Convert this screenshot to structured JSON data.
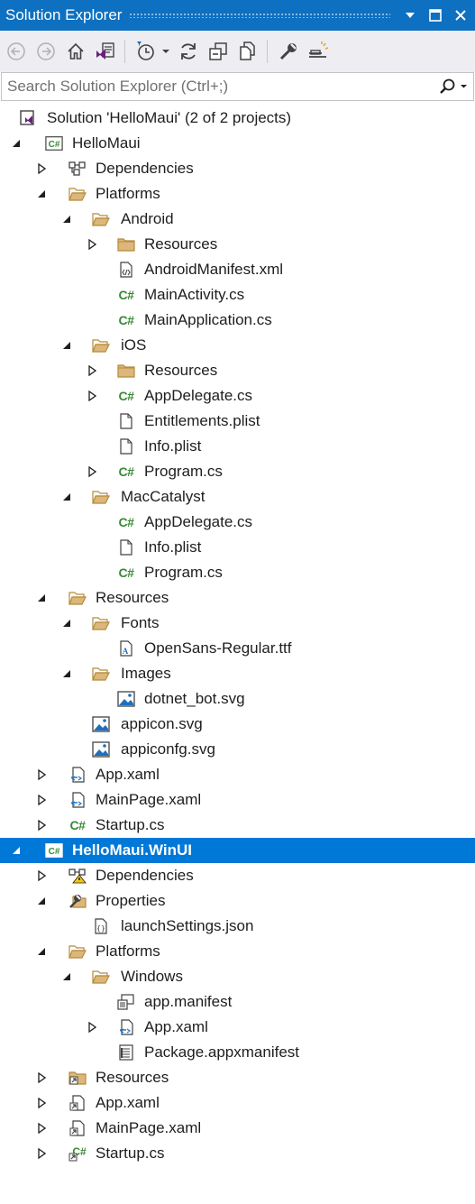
{
  "window": {
    "title": "Solution Explorer"
  },
  "search": {
    "placeholder": "Search Solution Explorer (Ctrl+;)"
  },
  "toolbar": {
    "buttons": [
      "back-icon",
      "forward-icon",
      "home-icon",
      "switch-views-icon",
      "pending-changes-filter-icon",
      "sync-icon",
      "collapse-all-icon",
      "show-all-files-icon",
      "properties-icon",
      "preview-icon"
    ]
  },
  "colors": {
    "accent": "#0e70c0",
    "selection": "#0078d7",
    "csharp": "#388a34",
    "folder": "#dcb67a",
    "toolbar_bg": "#eeeef2"
  },
  "tree": [
    {
      "label": "Solution 'HelloMaui' (2 of 2 projects)",
      "depth": 0,
      "expander": "none",
      "icon": "solution-icon"
    },
    {
      "label": "HelloMaui",
      "depth": 1,
      "expander": "expanded",
      "icon": "csharp-project-icon"
    },
    {
      "label": "Dependencies",
      "depth": 2,
      "expander": "collapsed",
      "icon": "dependencies-icon"
    },
    {
      "label": "Platforms",
      "depth": 2,
      "expander": "expanded",
      "icon": "folder-open-icon"
    },
    {
      "label": "Android",
      "depth": 3,
      "expander": "expanded",
      "icon": "folder-open-icon"
    },
    {
      "label": "Resources",
      "depth": 4,
      "expander": "collapsed",
      "icon": "folder-icon"
    },
    {
      "label": "AndroidManifest.xml",
      "depth": 4,
      "expander": "none",
      "icon": "xml-file-icon"
    },
    {
      "label": "MainActivity.cs",
      "depth": 4,
      "expander": "none",
      "icon": "csharp-file-icon"
    },
    {
      "label": "MainApplication.cs",
      "depth": 4,
      "expander": "none",
      "icon": "csharp-file-icon"
    },
    {
      "label": "iOS",
      "depth": 3,
      "expander": "expanded",
      "icon": "folder-open-icon"
    },
    {
      "label": "Resources",
      "depth": 4,
      "expander": "collapsed",
      "icon": "folder-icon"
    },
    {
      "label": "AppDelegate.cs",
      "depth": 4,
      "expander": "collapsed",
      "icon": "csharp-file-icon"
    },
    {
      "label": "Entitlements.plist",
      "depth": 4,
      "expander": "none",
      "icon": "file-icon"
    },
    {
      "label": "Info.plist",
      "depth": 4,
      "expander": "none",
      "icon": "file-icon"
    },
    {
      "label": "Program.cs",
      "depth": 4,
      "expander": "collapsed",
      "icon": "csharp-file-icon"
    },
    {
      "label": "MacCatalyst",
      "depth": 3,
      "expander": "expanded",
      "icon": "folder-open-icon"
    },
    {
      "label": "AppDelegate.cs",
      "depth": 4,
      "expander": "none",
      "icon": "csharp-file-icon"
    },
    {
      "label": "Info.plist",
      "depth": 4,
      "expander": "none",
      "icon": "file-icon"
    },
    {
      "label": "Program.cs",
      "depth": 4,
      "expander": "none",
      "icon": "csharp-file-icon"
    },
    {
      "label": "Resources",
      "depth": 2,
      "expander": "expanded",
      "icon": "folder-open-icon"
    },
    {
      "label": "Fonts",
      "depth": 3,
      "expander": "expanded",
      "icon": "folder-open-icon"
    },
    {
      "label": "OpenSans-Regular.ttf",
      "depth": 4,
      "expander": "none",
      "icon": "font-file-icon"
    },
    {
      "label": "Images",
      "depth": 3,
      "expander": "expanded",
      "icon": "folder-open-icon"
    },
    {
      "label": "dotnet_bot.svg",
      "depth": 4,
      "expander": "none",
      "icon": "image-file-icon"
    },
    {
      "label": "appicon.svg",
      "depth": 3,
      "expander": "none",
      "icon": "image-file-icon"
    },
    {
      "label": "appiconfg.svg",
      "depth": 3,
      "expander": "none",
      "icon": "image-file-icon"
    },
    {
      "label": "App.xaml",
      "depth": 2,
      "expander": "collapsed",
      "icon": "xaml-file-icon"
    },
    {
      "label": "MainPage.xaml",
      "depth": 2,
      "expander": "collapsed",
      "icon": "xaml-file-icon"
    },
    {
      "label": "Startup.cs",
      "depth": 2,
      "expander": "collapsed",
      "icon": "csharp-file-icon"
    },
    {
      "label": "HelloMaui.WinUI",
      "depth": 1,
      "expander": "expanded",
      "icon": "csharp-project-icon",
      "selected": true
    },
    {
      "label": "Dependencies",
      "depth": 2,
      "expander": "collapsed",
      "icon": "dependencies-warning-icon"
    },
    {
      "label": "Properties",
      "depth": 2,
      "expander": "expanded",
      "icon": "properties-folder-icon"
    },
    {
      "label": "launchSettings.json",
      "depth": 3,
      "expander": "none",
      "icon": "json-file-icon"
    },
    {
      "label": "Platforms",
      "depth": 2,
      "expander": "expanded",
      "icon": "folder-open-icon"
    },
    {
      "label": "Windows",
      "depth": 3,
      "expander": "expanded",
      "icon": "folder-open-icon"
    },
    {
      "label": "app.manifest",
      "depth": 4,
      "expander": "none",
      "icon": "manifest-file-icon"
    },
    {
      "label": "App.xaml",
      "depth": 4,
      "expander": "collapsed",
      "icon": "xaml-file-icon"
    },
    {
      "label": "Package.appxmanifest",
      "depth": 4,
      "expander": "none",
      "icon": "appxmanifest-file-icon"
    },
    {
      "label": "Resources",
      "depth": 2,
      "expander": "collapsed",
      "icon": "linked-folder-icon"
    },
    {
      "label": "App.xaml",
      "depth": 2,
      "expander": "collapsed",
      "icon": "linked-file-icon"
    },
    {
      "label": "MainPage.xaml",
      "depth": 2,
      "expander": "collapsed",
      "icon": "linked-file-icon"
    },
    {
      "label": "Startup.cs",
      "depth": 2,
      "expander": "collapsed",
      "icon": "linked-csharp-file-icon"
    }
  ]
}
